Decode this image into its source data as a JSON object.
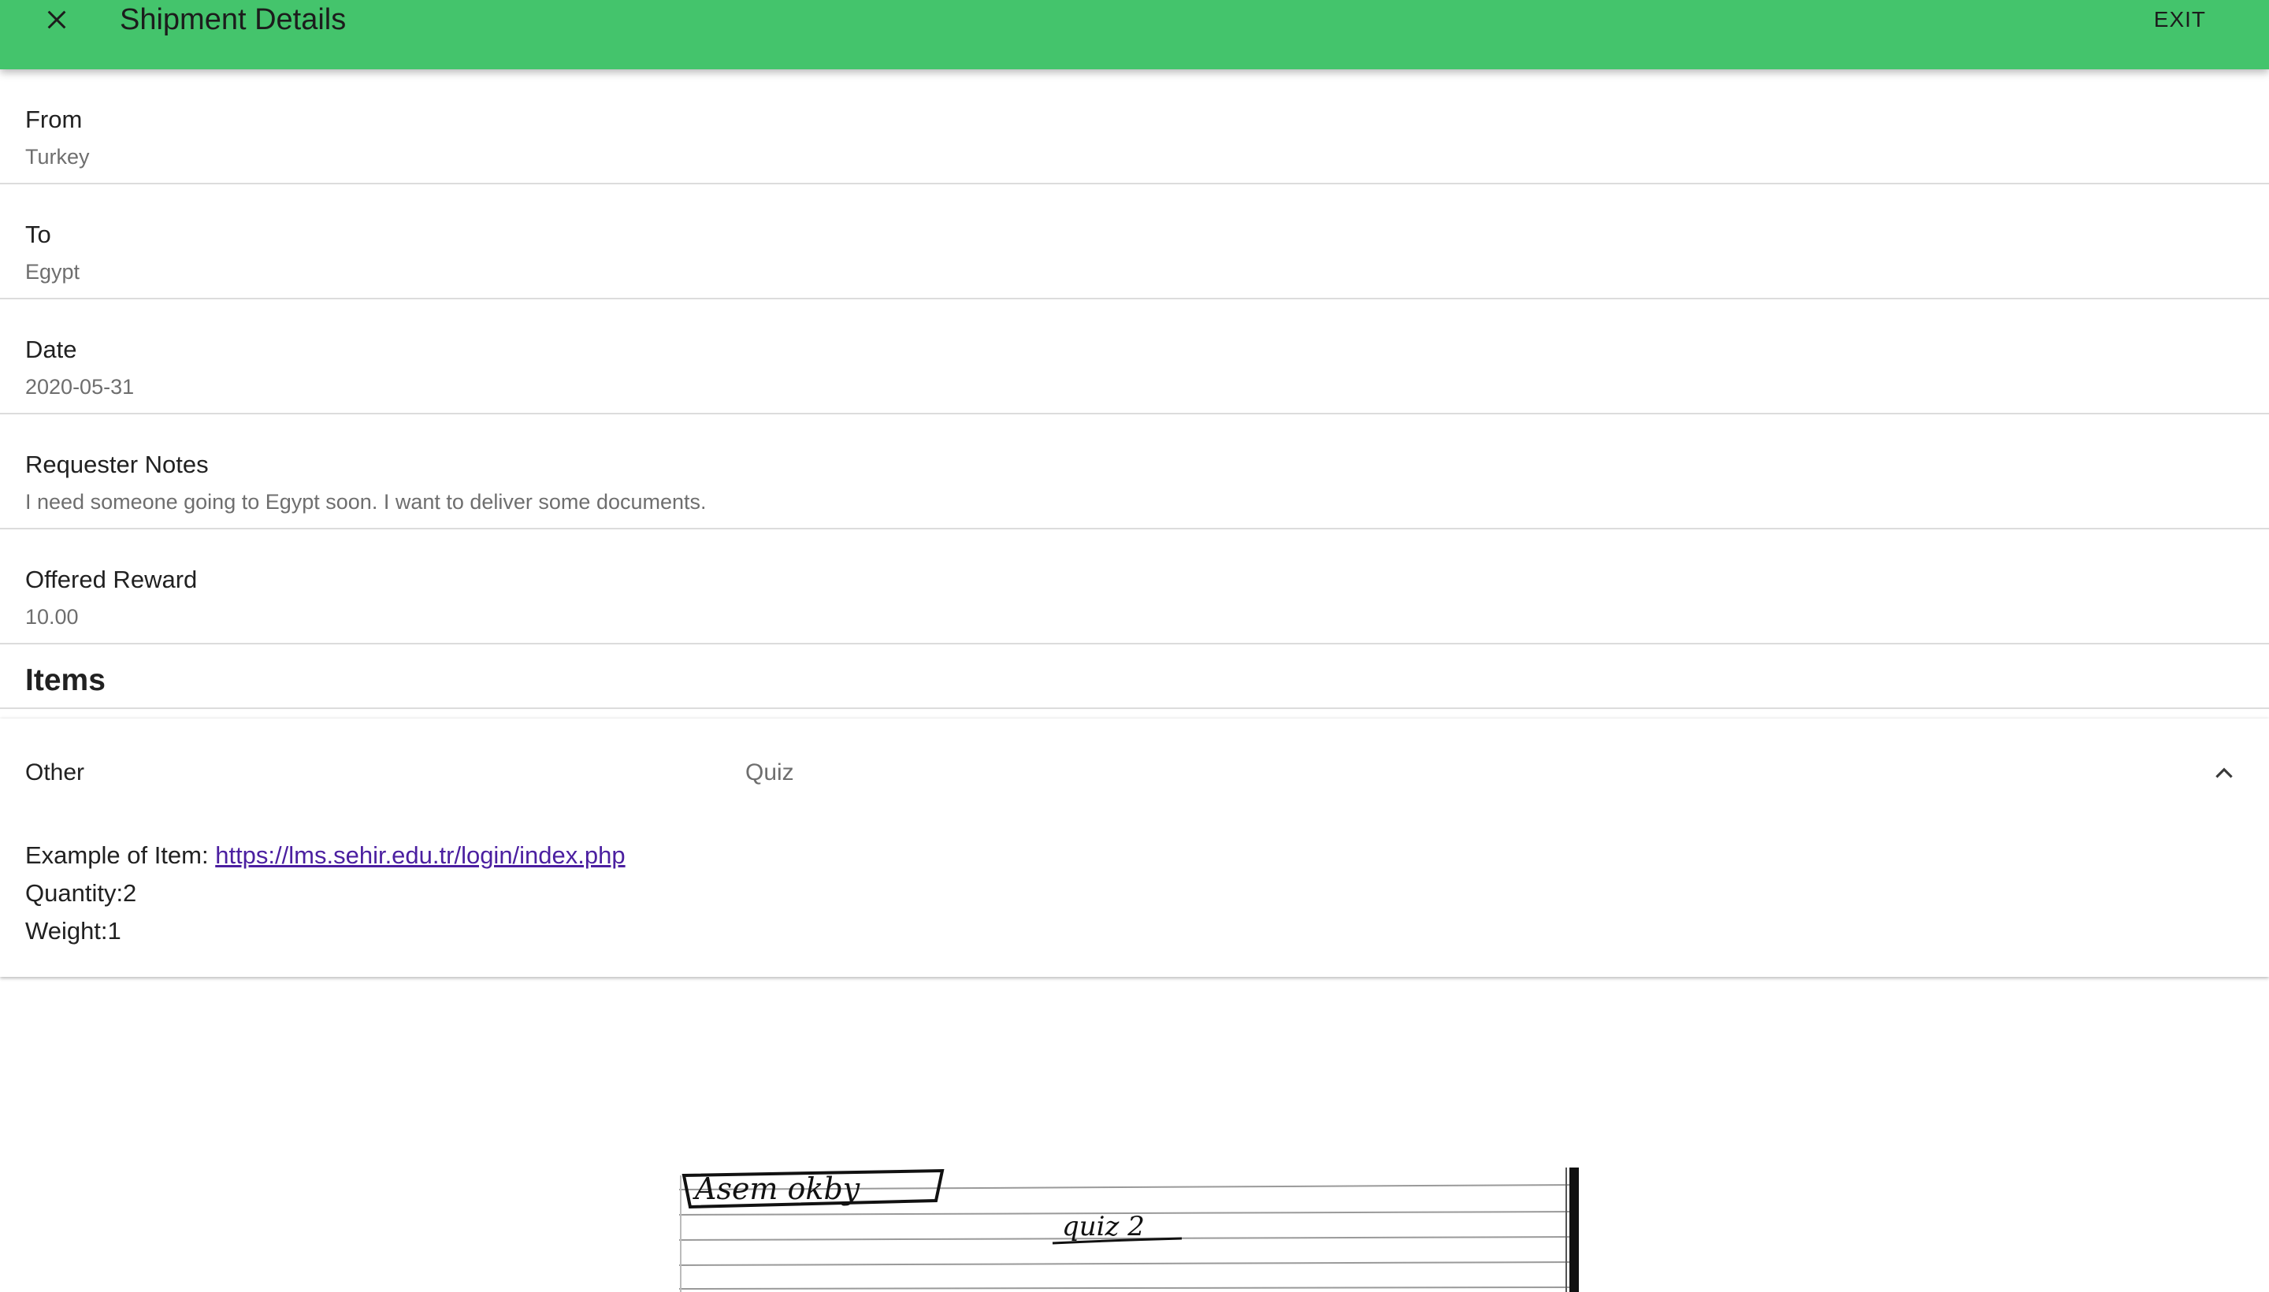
{
  "appbar": {
    "title": "Shipment Details",
    "exit_label": "EXIT",
    "close_icon": "close-icon",
    "background_color": "#44c46c"
  },
  "details": [
    {
      "label": "From",
      "value": "Turkey"
    },
    {
      "label": "To",
      "value": "Egypt"
    },
    {
      "label": "Date",
      "value": "2020-05-31"
    },
    {
      "label": "Requester Notes",
      "value": "I need someone going to Egypt soon. I want to deliver some documents."
    },
    {
      "label": "Offered Reward",
      "value": "10.00"
    }
  ],
  "items": {
    "title": "Items",
    "entries": [
      {
        "category": "Other",
        "name": "Quiz",
        "expanded": true,
        "chevron_icon": "chevron-up-icon",
        "example_label": "Example of Item: ",
        "example_link": "https://lms.sehir.edu.tr/login/index.php",
        "quantity_text": "Quantity:2",
        "weight_text": "Weight:1",
        "image": {
          "handwritten_name": "Asem okby",
          "handwritten_title": "quiz 2"
        }
      }
    ]
  }
}
